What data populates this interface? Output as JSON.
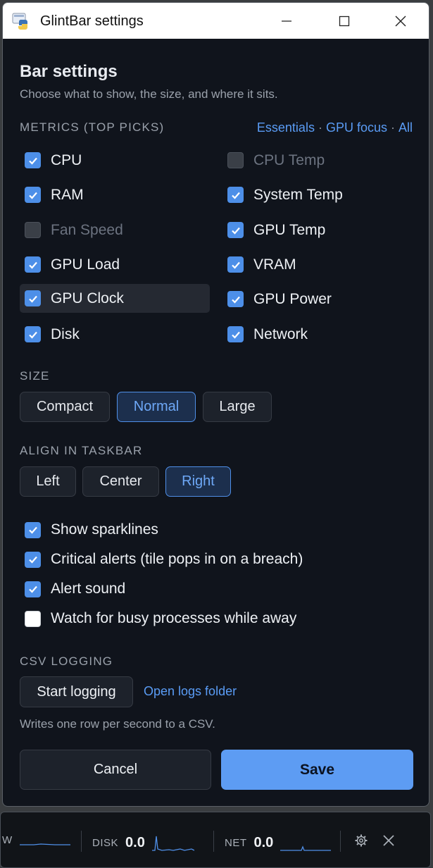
{
  "window": {
    "title": "GlintBar settings",
    "icons": {
      "app": "python-icon",
      "minimize": "minimize-icon",
      "maximize": "maximize-icon",
      "close": "close-icon"
    }
  },
  "header": {
    "title": "Bar settings",
    "subtitle": "Choose what to show, the size, and where it sits."
  },
  "metrics": {
    "section_label": "METRICS (TOP PICKS)",
    "presets": [
      "Essentials",
      "GPU focus",
      "All"
    ],
    "items": [
      {
        "label": "CPU",
        "checked": true,
        "enabled": true
      },
      {
        "label": "CPU Temp",
        "checked": false,
        "enabled": false
      },
      {
        "label": "RAM",
        "checked": true,
        "enabled": true
      },
      {
        "label": "System Temp",
        "checked": true,
        "enabled": true
      },
      {
        "label": "Fan Speed",
        "checked": false,
        "enabled": false
      },
      {
        "label": "GPU Temp",
        "checked": true,
        "enabled": true
      },
      {
        "label": "GPU Load",
        "checked": true,
        "enabled": true
      },
      {
        "label": "VRAM",
        "checked": true,
        "enabled": true
      },
      {
        "label": "GPU Clock",
        "checked": true,
        "enabled": true
      },
      {
        "label": "GPU Power",
        "checked": true,
        "enabled": true
      },
      {
        "label": "Disk",
        "checked": true,
        "enabled": true
      },
      {
        "label": "Network",
        "checked": true,
        "enabled": true
      }
    ]
  },
  "size": {
    "section_label": "SIZE",
    "options": [
      "Compact",
      "Normal",
      "Large"
    ],
    "selected": "Normal"
  },
  "align": {
    "section_label": "ALIGN IN TASKBAR",
    "options": [
      "Left",
      "Center",
      "Right"
    ],
    "selected": "Right"
  },
  "options": [
    {
      "label": "Show sparklines",
      "checked": true
    },
    {
      "label": "Critical alerts (tile pops in on a breach)",
      "checked": true
    },
    {
      "label": "Alert sound",
      "checked": true
    },
    {
      "label": "Watch for busy processes while away",
      "checked": false
    }
  ],
  "csv": {
    "section_label": "CSV LOGGING",
    "start_label": "Start logging",
    "open_folder_label": "Open logs folder",
    "note": "Writes one row per second to a CSV."
  },
  "footer": {
    "cancel_label": "Cancel",
    "save_label": "Save"
  },
  "taskbar": {
    "partial_label": "W",
    "disk_label": "DISK",
    "disk_value": "0.0",
    "net_label": "NET",
    "net_value": "0.0",
    "icons": {
      "settings": "gear-icon",
      "close": "close-icon"
    }
  },
  "colors": {
    "accent": "#5d9cf3",
    "background": "#10141c",
    "checkbox": "#4d8fe8"
  }
}
